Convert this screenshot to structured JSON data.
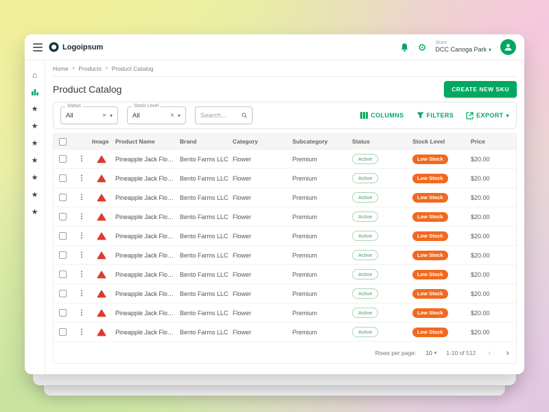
{
  "topbar": {
    "logo_text": "Logoipsum",
    "store_label": "Store",
    "store_value": "DCC Canoga Park"
  },
  "breadcrumb": {
    "items": [
      "Home",
      "Products",
      "Product Catalog"
    ]
  },
  "page": {
    "title": "Product Catalog",
    "create_button": "CREATE NEW SKU"
  },
  "filters": {
    "status": {
      "label": "Status",
      "value": "All"
    },
    "stock_level": {
      "label": "Stock Level",
      "value": "All"
    },
    "search_placeholder": "Search...",
    "columns_button": "COLUMNS",
    "filters_button": "FILTERS",
    "export_button": "EXPORT"
  },
  "table": {
    "headers": [
      "Image",
      "Product Name",
      "Brand",
      "Category",
      "Subcategory",
      "Status",
      "Stock Level",
      "Price"
    ],
    "rows": [
      {
        "product": "Pineapple Jack Flower",
        "brand": "Bento Farms LLC",
        "category": "Flower",
        "subcategory": "Premium",
        "status": "Active",
        "stock": "Low Stock",
        "price": "$20.00"
      },
      {
        "product": "Pineapple Jack Flower",
        "brand": "Bento Farms LLC",
        "category": "Flower",
        "subcategory": "Premium",
        "status": "Active",
        "stock": "Low Stock",
        "price": "$20.00"
      },
      {
        "product": "Pineapple Jack Flower",
        "brand": "Bento Farms LLC",
        "category": "Flower",
        "subcategory": "Premium",
        "status": "Active",
        "stock": "Low Stock",
        "price": "$20.00"
      },
      {
        "product": "Pineapple Jack Flower",
        "brand": "Bento Farms LLC",
        "category": "Flower",
        "subcategory": "Premium",
        "status": "Active",
        "stock": "Low Stock",
        "price": "$20.00"
      },
      {
        "product": "Pineapple Jack Flower",
        "brand": "Bento Farms LLC",
        "category": "Flower",
        "subcategory": "Premium",
        "status": "Active",
        "stock": "Low Stock",
        "price": "$20.00"
      },
      {
        "product": "Pineapple Jack Flower",
        "brand": "Bento Farms LLC",
        "category": "Flower",
        "subcategory": "Premium",
        "status": "Active",
        "stock": "Low Stock",
        "price": "$20.00"
      },
      {
        "product": "Pineapple Jack Flower",
        "brand": "Bento Farms LLC",
        "category": "Flower",
        "subcategory": "Premium",
        "status": "Active",
        "stock": "Low Stock",
        "price": "$20.00"
      },
      {
        "product": "Pineapple Jack Flower",
        "brand": "Bento Farms LLC",
        "category": "Flower",
        "subcategory": "Premium",
        "status": "Active",
        "stock": "Low Stock",
        "price": "$20.00"
      },
      {
        "product": "Pineapple Jack Flower",
        "brand": "Bento Farms LLC",
        "category": "Flower",
        "subcategory": "Premium",
        "status": "Active",
        "stock": "Low Stock",
        "price": "$20.00"
      },
      {
        "product": "Pineapple Jack Flower",
        "brand": "Bento Farms LLC",
        "category": "Flower",
        "subcategory": "Premium",
        "status": "Active",
        "stock": "Low Stock",
        "price": "$20.00"
      }
    ]
  },
  "pagination": {
    "rows_per_page_label": "Rows per page:",
    "rows_per_page_value": "10",
    "range_text": "1-10 of 512"
  },
  "icons": {
    "gear": "⚙",
    "home": "⌂",
    "star": "★",
    "kebab": "⋮",
    "chevron_down": "▾",
    "clear": "×",
    "chevron_left": "‹",
    "chevron_right": "›",
    "breadcrumb_sep": ">"
  },
  "colors": {
    "accent_green": "#00a862",
    "badge_orange": "#f2691d",
    "status_pill_green": "#4f9d68",
    "image_icon_red": "#df3a2e"
  }
}
